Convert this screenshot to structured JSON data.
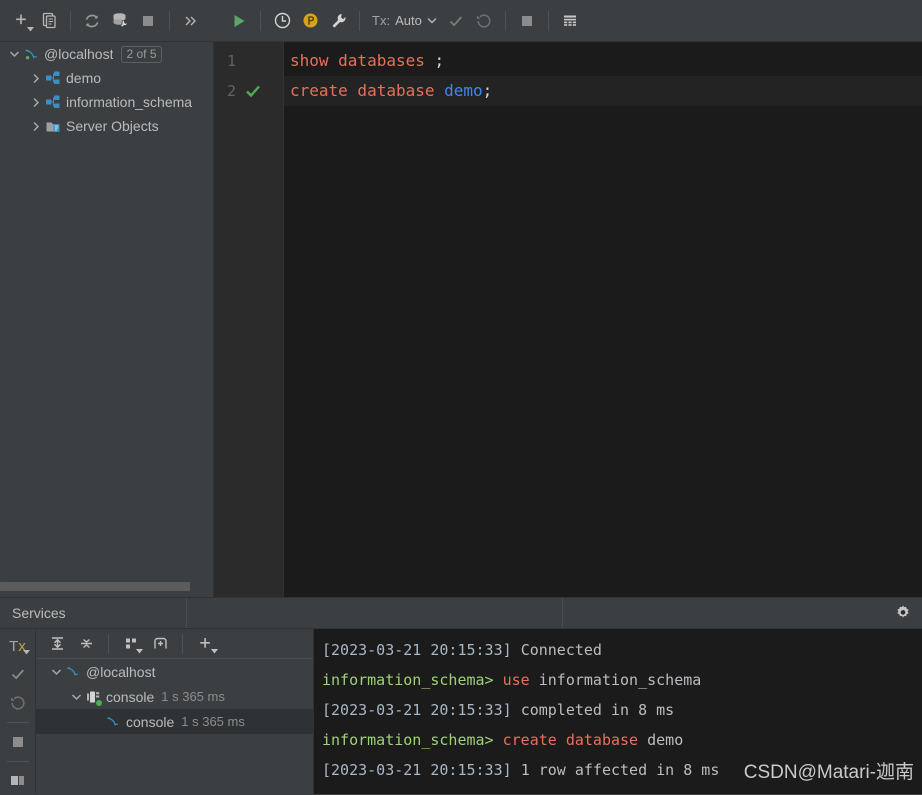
{
  "left_toolbar": {
    "buttons": [
      {
        "name": "add-datasource-button",
        "icon": "plus-dropdown-icon",
        "label": "+"
      },
      {
        "name": "duplicate-button",
        "icon": "copy-icon",
        "label": "Duplicate"
      },
      {
        "name": "refresh-button",
        "icon": "refresh-icon",
        "label": "Refresh"
      },
      {
        "name": "db-tools-button",
        "icon": "database-wrench-icon",
        "label": "Database Tools"
      },
      {
        "name": "stop-button",
        "icon": "stop-square-icon",
        "label": "Stop"
      },
      {
        "name": "more-button",
        "icon": "chevron-double-right-icon",
        "label": "»"
      }
    ]
  },
  "editor_toolbar": {
    "run_label": "Execute",
    "history_label": "History",
    "profile_label": "Profile",
    "tools_label": "Tools",
    "tx_label": "Tx:",
    "tx_value": "Auto",
    "commit_label": "Commit",
    "rollback_label": "Rollback",
    "stop_label": "Stop",
    "grid_label": "Output Grid"
  },
  "db_tree": {
    "items": [
      {
        "label": "@localhost",
        "icon": "mysql-dolphin-icon",
        "level": 0,
        "expanded": true,
        "badge": "2 of 5"
      },
      {
        "label": "demo",
        "icon": "schema-icon",
        "level": 1,
        "expanded": false,
        "badge": ""
      },
      {
        "label": "information_schema",
        "icon": "schema-icon",
        "level": 1,
        "expanded": false,
        "badge": ""
      },
      {
        "label": "Server Objects",
        "icon": "server-objects-icon",
        "level": 1,
        "expanded": false,
        "badge": ""
      }
    ]
  },
  "editor": {
    "lines": [
      {
        "number": "1",
        "status": "",
        "segments": [
          {
            "text": "show databases ",
            "type": "kw"
          },
          {
            "text": ";",
            "type": "punc"
          }
        ]
      },
      {
        "number": "2",
        "status": "ok",
        "segments": [
          {
            "text": "create database ",
            "type": "kw"
          },
          {
            "text": "demo",
            "type": "ident"
          },
          {
            "text": ";",
            "type": "punc"
          }
        ]
      }
    ]
  },
  "services_tabbar": {
    "tab_label": "Services",
    "settings_label": "Settings"
  },
  "services_vtoolbar": {
    "buttons": [
      {
        "name": "tx-mode-button",
        "icon": "tx-dropdown-icon",
        "label": "Tx"
      },
      {
        "name": "commit-button",
        "icon": "check-icon",
        "label": "Commit"
      },
      {
        "name": "rollback-button",
        "icon": "rollback-icon",
        "label": "Rollback"
      },
      {
        "name": "stop-button",
        "icon": "stop-square-icon",
        "label": "Stop"
      }
    ]
  },
  "services_toolbar": {
    "buttons": [
      {
        "name": "expand-all-button",
        "icon": "expand-all-icon",
        "label": "Expand All"
      },
      {
        "name": "collapse-all-button",
        "icon": "collapse-all-icon",
        "label": "Collapse All"
      },
      {
        "name": "group-by-button",
        "icon": "group-by-dropdown-icon",
        "label": "Group By"
      },
      {
        "name": "new-tab-button",
        "icon": "add-tab-icon",
        "label": "New Tab"
      },
      {
        "name": "add-button",
        "icon": "plus-dropdown-icon",
        "label": "Add"
      }
    ]
  },
  "services_tree": {
    "items": [
      {
        "label": "@localhost",
        "time": "",
        "icon": "mysql-dolphin-icon",
        "level": 0,
        "expanded": true,
        "selected": false
      },
      {
        "label": "console",
        "time": "1 s 365 ms",
        "icon": "connection-icon",
        "level": 1,
        "expanded": true,
        "selected": false
      },
      {
        "label": "console",
        "time": "1 s 365 ms",
        "icon": "mysql-dolphin-icon",
        "level": 2,
        "expanded": false,
        "selected": true
      }
    ]
  },
  "console_output": {
    "lines": [
      [
        {
          "text": "[2023-03-21 20:15:33] ",
          "type": "ts"
        },
        {
          "text": "Connected",
          "type": "plain"
        }
      ],
      [
        {
          "text": "information_schema> ",
          "type": "prompt"
        },
        {
          "text": "use ",
          "type": "sqlkw"
        },
        {
          "text": "information_schema",
          "type": "plain"
        }
      ],
      [
        {
          "text": "[2023-03-21 20:15:33] ",
          "type": "ts"
        },
        {
          "text": "completed in 8 ms",
          "type": "plain"
        }
      ],
      [
        {
          "text": "information_schema> ",
          "type": "prompt"
        },
        {
          "text": "create database ",
          "type": "sqlkw"
        },
        {
          "text": "demo",
          "type": "plain"
        }
      ],
      [
        {
          "text": "[2023-03-21 20:15:33] ",
          "type": "ts"
        },
        {
          "text": "1 row affected in 8 ms",
          "type": "plain"
        }
      ]
    ],
    "watermark": "CSDN@Matari-迦南"
  },
  "colors": {
    "panel_bg": "#3c3f41",
    "editor_bg": "#1b1b1b",
    "gutter_bg": "#2b2b2b",
    "text": "#bbbbbb",
    "keyword": "#e8705a",
    "identifier": "#3d87f5",
    "prompt_green": "#9fd177",
    "timestamp": "#a9b7c6",
    "run_green": "#59a869",
    "profile_orange": "#d9a21b",
    "schema_blue": "#3592c4"
  }
}
